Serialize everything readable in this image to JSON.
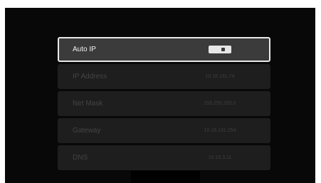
{
  "settings": {
    "items": [
      {
        "label": "Auto IP",
        "value": "",
        "control": "toggle",
        "toggle_state": "on",
        "selected": true
      },
      {
        "label": "IP Address",
        "value": "10.16.131.74"
      },
      {
        "label": "Net Mask",
        "value": "255.255.255.0"
      },
      {
        "label": "Gateway",
        "value": "10.16.131.254"
      },
      {
        "label": "DNS",
        "value": "10.16.3.11"
      }
    ]
  },
  "colors": {
    "background": "#080808",
    "row_background": "#1e1e1e",
    "selected_row_background": "#3b3b3b",
    "selected_border": "#e8e8e8",
    "dim_text": "#444444",
    "selected_text": "#f2f2f2"
  }
}
